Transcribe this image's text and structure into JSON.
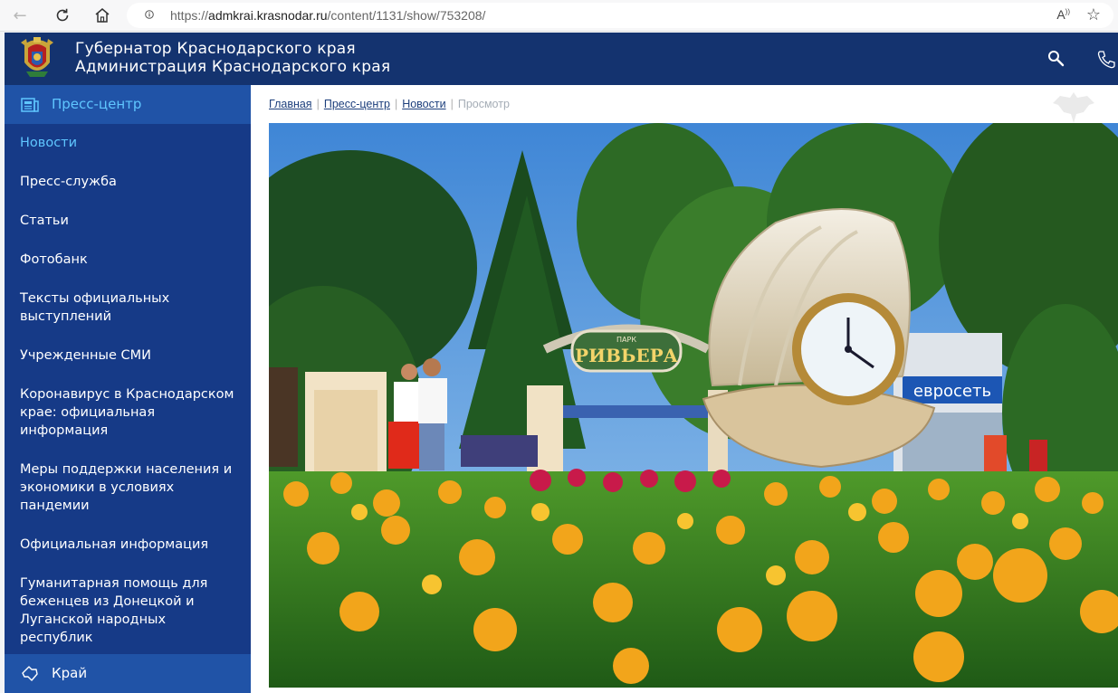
{
  "browser": {
    "url_prefix": "https://",
    "url_host": "admkrai.krasnodar.ru",
    "url_path": "/content/1131/show/753208/",
    "read_aloud": "Aᵃ"
  },
  "header": {
    "title_line1": "Губернатор Краснодарского края",
    "title_line2": "Администрация Краснодарского края"
  },
  "sidebar": {
    "section_title": "Пресс-центр",
    "items": [
      {
        "label": "Новости",
        "active": true
      },
      {
        "label": "Пресс-служба"
      },
      {
        "label": "Статьи"
      },
      {
        "label": "Фотобанк"
      },
      {
        "label": "Тексты официальных выступлений"
      },
      {
        "label": "Учрежденные СМИ"
      },
      {
        "label": "Коронавирус в Краснодарском крае: официальная информация"
      },
      {
        "label": "Меры поддержки населения и экономики в условиях пандемии"
      },
      {
        "label": "Официальная информация"
      },
      {
        "label": "Гуманитарная помощь для беженцев из Донецкой и Луганской народных республик"
      }
    ],
    "footer_label": "Край"
  },
  "breadcrumb": {
    "home": "Главная",
    "press": "Пресс-центр",
    "news": "Новости",
    "current": "Просмотр"
  },
  "photo": {
    "arch_text": "РИВЬЕРА",
    "arch_small": "ПАРК",
    "shop_text": "евросеть"
  },
  "colors": {
    "header_bg": "#14336f",
    "sidebar_bg": "#163a87",
    "sidebar_highlight": "#2053a7",
    "accent": "#5fc6ff"
  }
}
